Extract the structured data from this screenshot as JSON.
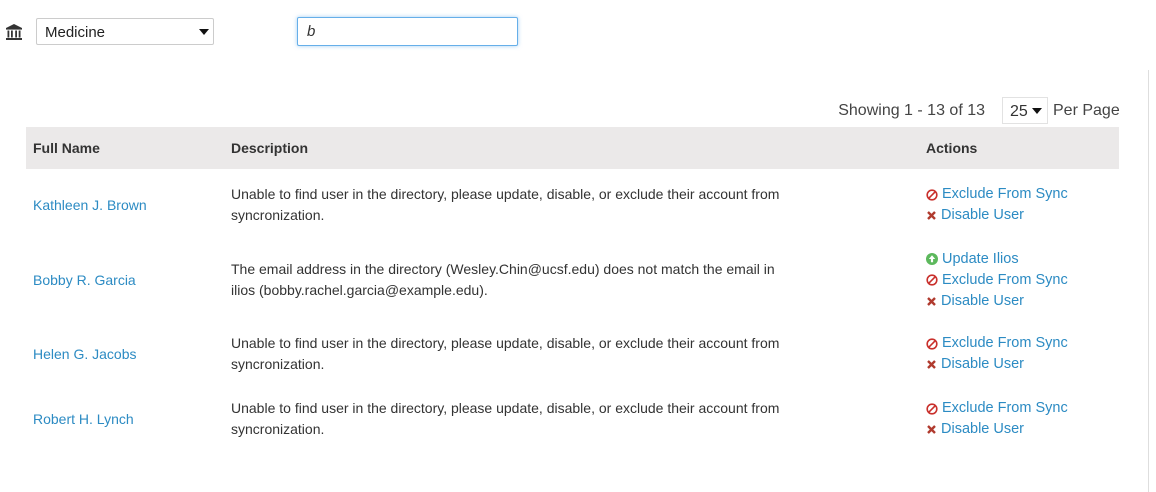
{
  "filters": {
    "school_selected": "Medicine",
    "search_value": "b"
  },
  "pagination": {
    "showing_text": "Showing 1 - 13 of 13",
    "per_page_value": "25",
    "per_page_label": "Per Page"
  },
  "table": {
    "headers": {
      "name": "Full Name",
      "description": "Description",
      "actions": "Actions"
    },
    "rows": [
      {
        "name": "Kathleen J. Brown",
        "description": "Unable to find user in the directory, please update, disable, or exclude their account from syncronization.",
        "actions": [
          {
            "label": "Exclude From Sync",
            "icon": "ban-icon"
          },
          {
            "label": "Disable User",
            "icon": "times-icon"
          }
        ]
      },
      {
        "name": "Bobby R. Garcia",
        "description": "The email address in the directory (Wesley.Chin@ucsf.edu) does not match the email in ilios (bobby.rachel.garcia@example.edu).",
        "actions": [
          {
            "label": "Update Ilios",
            "icon": "arrow-circle-up-icon"
          },
          {
            "label": "Exclude From Sync",
            "icon": "ban-icon"
          },
          {
            "label": "Disable User",
            "icon": "times-icon"
          }
        ]
      },
      {
        "name": "Helen G. Jacobs",
        "description": "Unable to find user in the directory, please update, disable, or exclude their account from syncronization.",
        "actions": [
          {
            "label": "Exclude From Sync",
            "icon": "ban-icon"
          },
          {
            "label": "Disable User",
            "icon": "times-icon"
          }
        ]
      },
      {
        "name": "Robert H. Lynch",
        "description": "Unable to find user in the directory, please update, disable, or exclude their account from syncronization.",
        "actions": [
          {
            "label": "Exclude From Sync",
            "icon": "ban-icon"
          },
          {
            "label": "Disable User",
            "icon": "times-icon"
          }
        ]
      }
    ]
  },
  "colors": {
    "link": "#2c8bc3",
    "header_bg": "#ebe9e9",
    "ban": "#c9302c",
    "times": "#b03a2e",
    "update": "#5cb85c"
  }
}
